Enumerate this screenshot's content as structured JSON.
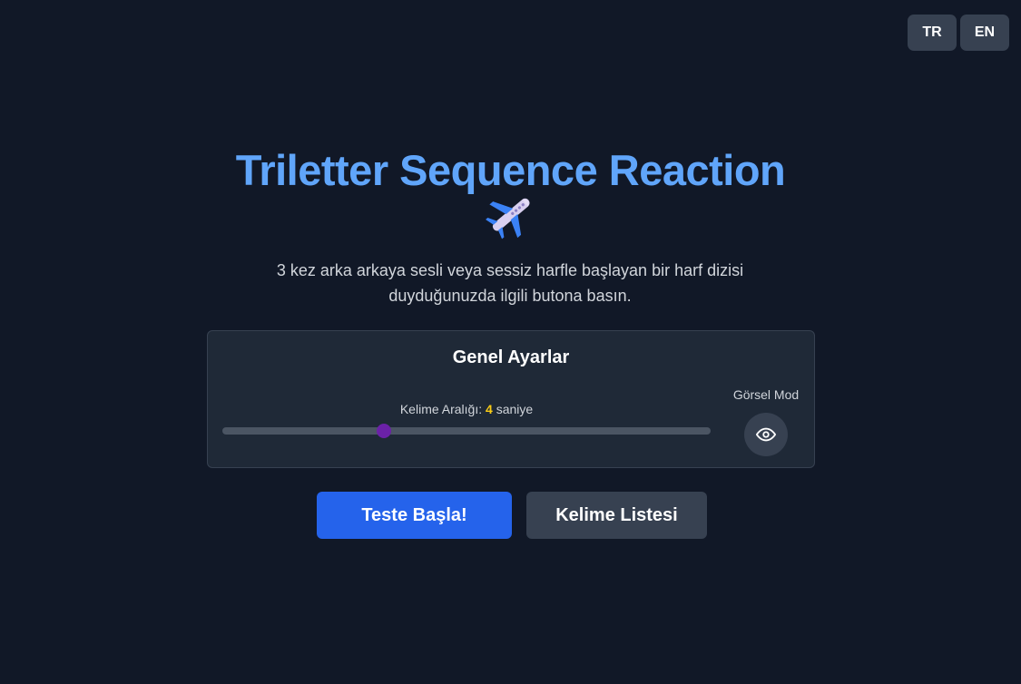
{
  "language_switch": {
    "options": [
      "TR",
      "EN"
    ]
  },
  "header": {
    "title": "Triletter Sequence Reaction"
  },
  "icons": {
    "title_icon": "airplane-icon",
    "visual_mode_icon": "eye-icon"
  },
  "description": "3 kez arka arkaya sesli veya sessiz harfle başlayan bir harf dizisi duyduğunuzda ilgili butona basın.",
  "settings": {
    "title": "Genel Ayarlar",
    "interval_label": "Kelime Aralığı:",
    "interval_value": "4",
    "interval_unit": "saniye",
    "slider_fraction": 0.33,
    "visual_mode_label": "Görsel Mod"
  },
  "actions": {
    "start_label": "Teste Başla!",
    "word_list_label": "Kelime Listesi"
  },
  "colors": {
    "background": "#111827",
    "title": "#60a5fa",
    "accent_value": "#facc15",
    "primary_button": "#2563eb",
    "secondary_button": "#374151",
    "slider_thumb": "#6b21a8"
  }
}
